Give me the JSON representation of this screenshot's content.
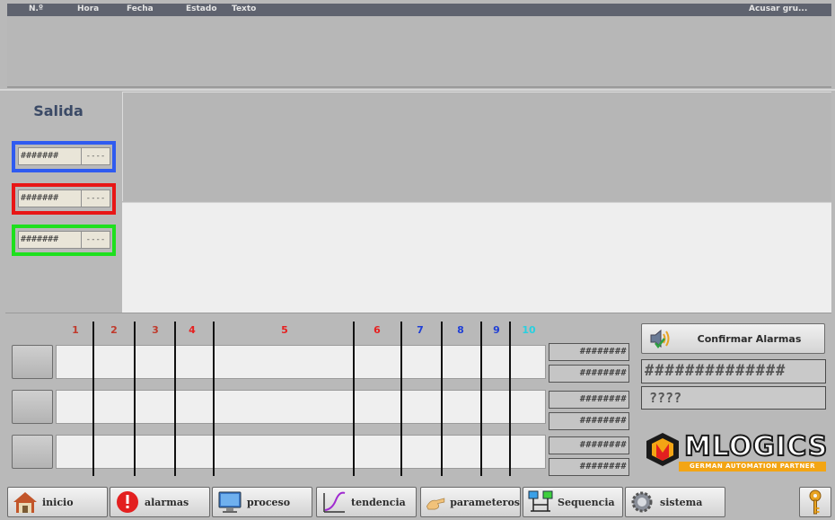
{
  "alarm_header": {
    "columns": [
      "N.º",
      "Hora",
      "Fecha",
      "Estado",
      "Texto"
    ],
    "ack_group": "Acusar gru..."
  },
  "left_panel": {
    "title": "Salida",
    "status_boxes": [
      {
        "value": "#######",
        "unit": "----",
        "color": "#2f5bf0"
      },
      {
        "value": "#######",
        "unit": "----",
        "color": "#e81616"
      },
      {
        "value": "#######",
        "unit": "----",
        "color": "#1ee01e"
      }
    ]
  },
  "grid": {
    "columns": [
      {
        "label": "1",
        "color": "#c0392b"
      },
      {
        "label": "2",
        "color": "#c0392b"
      },
      {
        "label": "3",
        "color": "#c0392b"
      },
      {
        "label": "4",
        "color": "#e62020"
      },
      {
        "label": "5",
        "color": "#e62020"
      },
      {
        "label": "6",
        "color": "#e62020"
      },
      {
        "label": "7",
        "color": "#1f3fd6"
      },
      {
        "label": "8",
        "color": "#1f3fd6"
      },
      {
        "label": "9",
        "color": "#1f3fd6"
      },
      {
        "label": "10",
        "color": "#28d0e0"
      }
    ],
    "hash_values": [
      "########",
      "########",
      "########",
      "########",
      "########",
      "########"
    ]
  },
  "right_panel": {
    "confirm_label": "Confirmar Alarmas",
    "big_value": "##############",
    "unknown_value": "????"
  },
  "logo": {
    "name": "MLOGICS",
    "tagline": "GERMAN AUTOMATION PARTNER"
  },
  "nav": [
    {
      "label": "inicio",
      "icon": "home-icon"
    },
    {
      "label": "alarmas",
      "icon": "alarm-icon"
    },
    {
      "label": "proceso",
      "icon": "monitor-icon"
    },
    {
      "label": "tendencia",
      "icon": "trend-icon"
    },
    {
      "label": "parameteros",
      "icon": "hand-icon"
    },
    {
      "label": "Sequencia",
      "icon": "sequence-icon"
    },
    {
      "label": "sistema",
      "icon": "gear-icon"
    }
  ],
  "colors": {
    "accent_orange": "#f3a514",
    "alarm_red": "#e32020"
  }
}
